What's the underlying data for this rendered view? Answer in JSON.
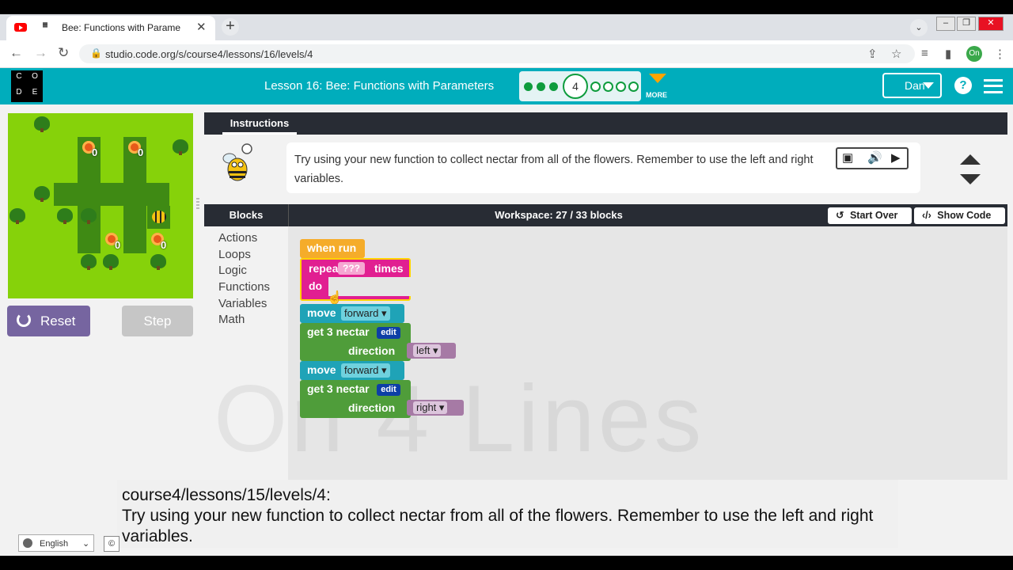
{
  "browser": {
    "tab_title": "Bee: Functions with Paramet",
    "url": "studio.code.org/s/course4/lessons/16/levels/4",
    "profile_initials": "On",
    "new_tab": "+",
    "close_tab": "✕"
  },
  "header": {
    "logo_letters": [
      "C",
      "O",
      "D",
      "E"
    ],
    "lesson_title": "Lesson 16: Bee: Functions with Parameters",
    "current_level": "4",
    "more_label": "MORE",
    "user_name": "Dan",
    "help_label": "?"
  },
  "maze": {
    "flower_counts": [
      "0",
      "0",
      "0",
      "0"
    ]
  },
  "controls": {
    "reset_label": "Reset",
    "step_label": "Step"
  },
  "instructions": {
    "tab_label": "Instructions",
    "text": "Try using your new function to collect nectar from all of the flowers. Remember to use the left and right variables."
  },
  "workspace": {
    "blocks_title": "Blocks",
    "title": "Workspace: 27 / 33 blocks",
    "start_over_label": "Start Over",
    "show_code_label": "Show Code",
    "categories": [
      "Actions",
      "Loops",
      "Logic",
      "Functions",
      "Variables",
      "Math"
    ],
    "blocks": {
      "when_run": "when run",
      "repeat_label": "repeat",
      "repeat_value": "???",
      "repeat_times": "times",
      "do_label": "do",
      "move_label": "move",
      "move_dir": "forward ▾",
      "func_label": "get 3 nectar",
      "edit_label": "edit",
      "param_label": "direction",
      "var_left": "left ▾",
      "var_right": "right ▾"
    },
    "watermark": "On 4 Lines"
  },
  "caption": {
    "line1": "course4/lessons/15/levels/4:",
    "line2": "Try using your new function to collect nectar from all of the flowers. Remember to use the left and right variables."
  },
  "footer": {
    "language": "English",
    "copyright": "©"
  },
  "colors": {
    "header_teal": "#00adbc",
    "reset_purple": "#7665a0",
    "repeat_pink": "#e11f91",
    "when_run_orange": "#f5ac2a",
    "move_teal": "#1fa3b7",
    "function_green": "#4f9d3a",
    "variable_purple": "#a67aa5"
  }
}
